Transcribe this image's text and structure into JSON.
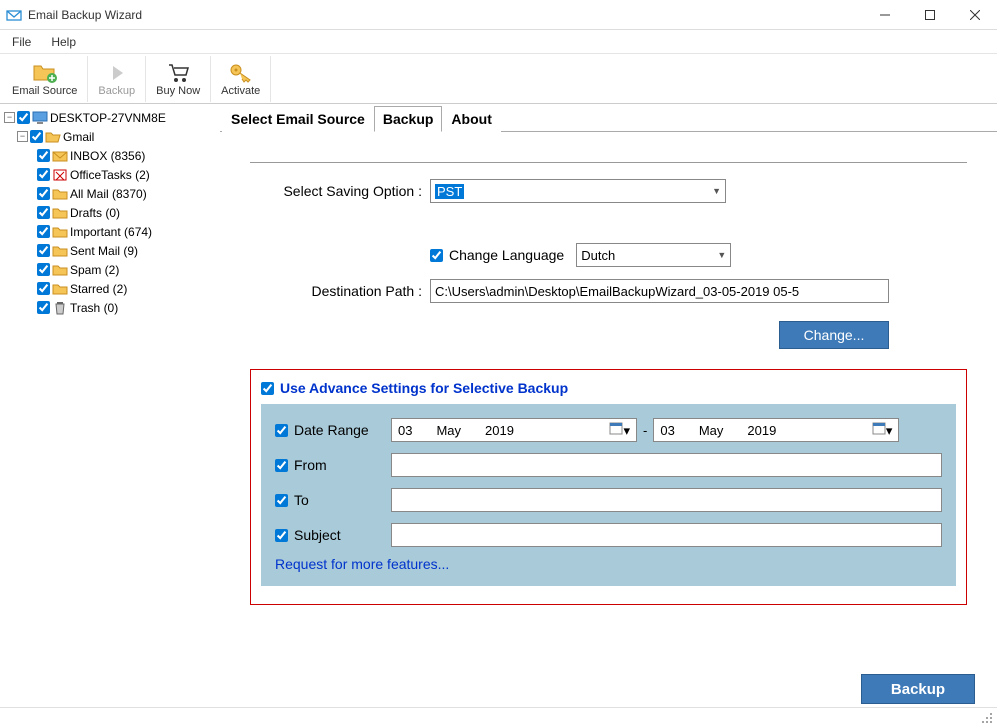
{
  "window": {
    "title": "Email Backup Wizard"
  },
  "menu": {
    "file": "File",
    "help": "Help"
  },
  "toolbar": {
    "email_source": "Email Source",
    "backup": "Backup",
    "buy_now": "Buy Now",
    "activate": "Activate"
  },
  "tree": {
    "root": "DESKTOP-27VNM8E",
    "account": "Gmail",
    "folders": [
      "INBOX (8356)",
      "OfficeTasks (2)",
      "All Mail (8370)",
      "Drafts (0)",
      "Important (674)",
      "Sent Mail (9)",
      "Spam (2)",
      "Starred (2)",
      "Trash (0)"
    ]
  },
  "tabs": {
    "t0": "Select Email Source",
    "t1": "Backup",
    "t2": "About"
  },
  "form": {
    "saving_label": "Select Saving Option :",
    "saving_value": "PST",
    "change_lang_label": "Change Language",
    "lang_value": "Dutch",
    "dest_label": "Destination Path :",
    "dest_value": "C:\\Users\\admin\\Desktop\\EmailBackupWizard_03-05-2019 05-5",
    "change_btn": "Change..."
  },
  "adv": {
    "title": "Use Advance Settings for Selective Backup",
    "date_range": "Date Range",
    "from": "From",
    "to": "To",
    "subject": "Subject",
    "request": "Request for more features...",
    "date1": {
      "d": "03",
      "m": "May",
      "y": "2019"
    },
    "date2": {
      "d": "03",
      "m": "May",
      "y": "2019"
    }
  },
  "buttons": {
    "backup": "Backup"
  }
}
